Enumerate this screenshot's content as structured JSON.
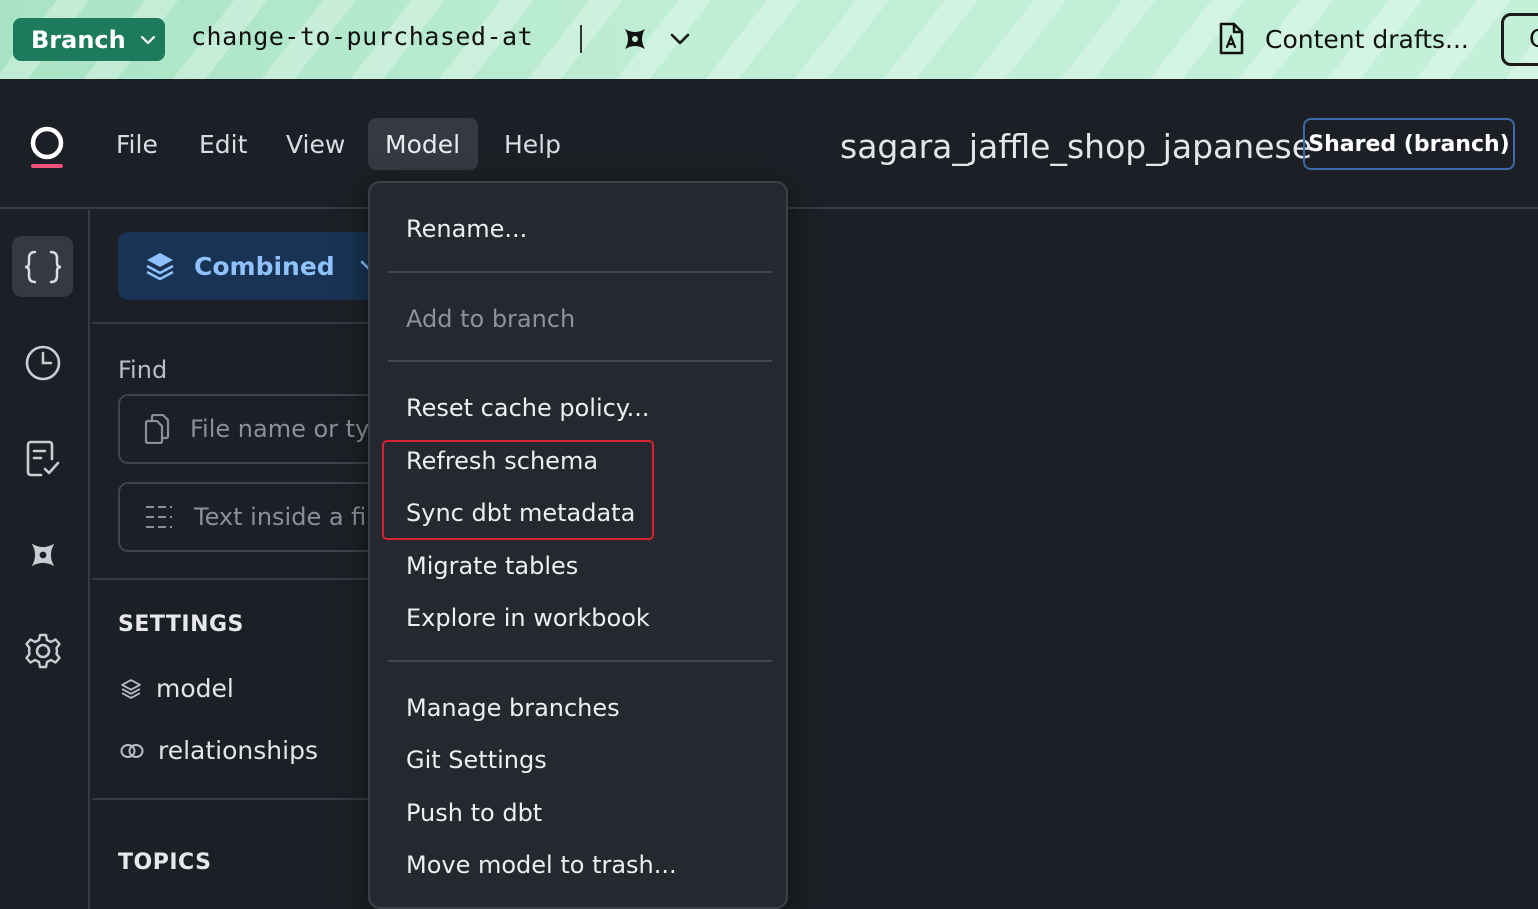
{
  "banner": {
    "branch_label": "Branch",
    "branch_name": "change-to-purchased-at",
    "drafts_label": "Content drafts...",
    "cut_button_text": "C"
  },
  "menubar": {
    "items": [
      "File",
      "Edit",
      "View",
      "Model",
      "Help"
    ],
    "active": "Model"
  },
  "header": {
    "model_title": "sagara_jaffle_shop_japanese",
    "shared_badge": "Shared (branch)"
  },
  "sidebar": {
    "combined_label": "Combined",
    "find_label": "Find",
    "file_search_placeholder": "File name or type",
    "text_search_placeholder": "Text inside a file",
    "settings_heading": "SETTINGS",
    "settings_items": [
      "model",
      "relationships"
    ],
    "topics_heading": "TOPICS"
  },
  "model_menu": {
    "items": [
      "Rename...",
      "Add to branch",
      "Reset cache policy...",
      "Refresh schema",
      "Sync dbt metadata",
      "Migrate tables",
      "Explore in workbook",
      "Manage branches",
      "Git Settings",
      "Push to dbt",
      "Move model to trash..."
    ],
    "disabled": [
      "Add to branch"
    ],
    "highlighted": [
      "Refresh schema",
      "Sync dbt metadata"
    ]
  },
  "colors": {
    "banner": "#bfeed5",
    "branch_button": "#1d7a5c",
    "background": "#1c1f25",
    "menu_background": "#25282e",
    "combined_background": "#183353",
    "combined_text": "#8fc2ff",
    "shared_border": "#3d6aa5",
    "highlight_border": "#d9222f",
    "logo_accent": "#f0507a"
  },
  "icons": {
    "logo": "app-logo",
    "rail": [
      "braces-icon",
      "clock-icon",
      "checklist-icon",
      "dbt-icon",
      "gear-icon"
    ]
  }
}
